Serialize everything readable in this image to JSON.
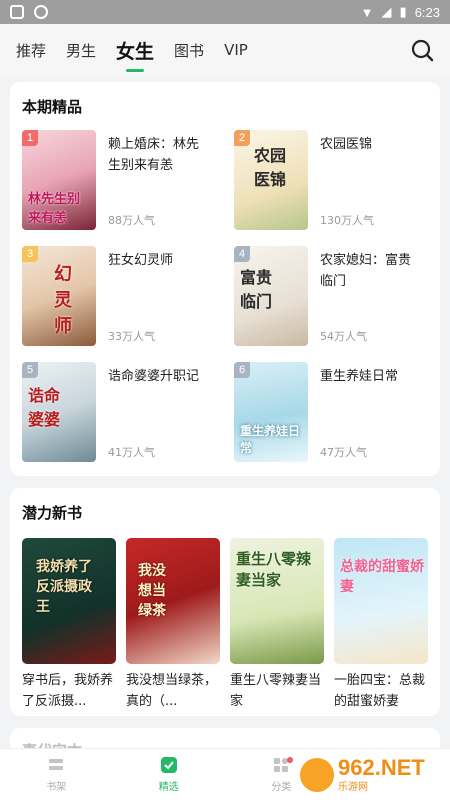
{
  "status_bar": {
    "time": "6:23"
  },
  "tabs": [
    "推荐",
    "男生",
    "女生",
    "图书",
    "VIP"
  ],
  "active_tab_index": 2,
  "section1": {
    "title": "本期精品",
    "books": [
      {
        "rank": "1",
        "title": "赖上婚床：林先生别来有恙",
        "popularity": "88万人气",
        "cover_text": "林先生别来有恙"
      },
      {
        "rank": "2",
        "title": "农园医锦",
        "popularity": "130万人气",
        "cover_text": "农园医锦"
      },
      {
        "rank": "3",
        "title": "狂女幻灵师",
        "popularity": "33万人气",
        "cover_text": "幻灵师"
      },
      {
        "rank": "4",
        "title": "农家媳妇：富贵临门",
        "popularity": "54万人气",
        "cover_text": "富贵临门"
      },
      {
        "rank": "5",
        "title": "诰命婆婆升职记",
        "popularity": "41万人气",
        "cover_text": "诰命婆婆"
      },
      {
        "rank": "6",
        "title": "重生养娃日常",
        "popularity": "47万人气",
        "cover_text": "重生养娃日常"
      }
    ]
  },
  "section2": {
    "title": "潜力新书",
    "books": [
      {
        "title": "穿书后，我娇养了反派摄...",
        "cover_text": "我娇养了反派摄政王"
      },
      {
        "title": "我没想当绿茶，真的（...",
        "cover_text": "我没想当绿茶"
      },
      {
        "title": "重生八零辣妻当家",
        "cover_text": "重生八零辣妻当家"
      },
      {
        "title": "一胎四宝：总裁的甜蜜娇妻",
        "cover_text": "总裁的甜蜜娇妻"
      }
    ]
  },
  "section3": {
    "title": "事代完本"
  },
  "bottom_nav": [
    {
      "label": "书架",
      "icon": "bookshelf-icon"
    },
    {
      "label": "精选",
      "icon": "featured-icon"
    },
    {
      "label": "分类",
      "icon": "category-icon"
    },
    {
      "label": "",
      "icon": "profile-icon"
    }
  ],
  "watermark": {
    "main": "962.NET",
    "sub": "乐游网"
  },
  "colors": {
    "accent": "#26b867",
    "rank1": "#f36a6a",
    "rank2": "#f5a05a",
    "rank3": "#f5c35a",
    "rank_other": "#a9b4c2"
  }
}
